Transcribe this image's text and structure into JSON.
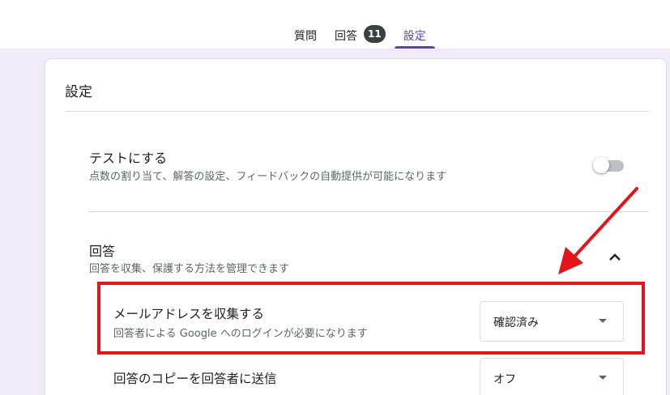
{
  "tabs": [
    {
      "label": "質問"
    },
    {
      "label": "回答",
      "badge": "11"
    },
    {
      "label": "設定"
    }
  ],
  "active_tab": "設定",
  "settings": {
    "title": "設定",
    "quiz": {
      "title": "テストにする",
      "description": "点数の割り当て、解答の設定、フィードバックの自動提供が可能になります",
      "toggle_on": false
    },
    "responses": {
      "title": "回答",
      "description": "回答を収集、保護する方法を管理できます",
      "expanded": true,
      "collect_email": {
        "title": "メールアドレスを収集する",
        "description": "回答者による Google へのログインが必要になります",
        "value": "確認済み"
      },
      "send_copy": {
        "title": "回答のコピーを回答者に送信",
        "value": "オフ"
      }
    }
  },
  "colors": {
    "accent": "#673ab7",
    "background": "#f0ebf8",
    "annotation_red": "#e3151a"
  },
  "icons": [
    "chevron-up-icon",
    "dropdown-caret-icon",
    "annotation-arrow"
  ]
}
